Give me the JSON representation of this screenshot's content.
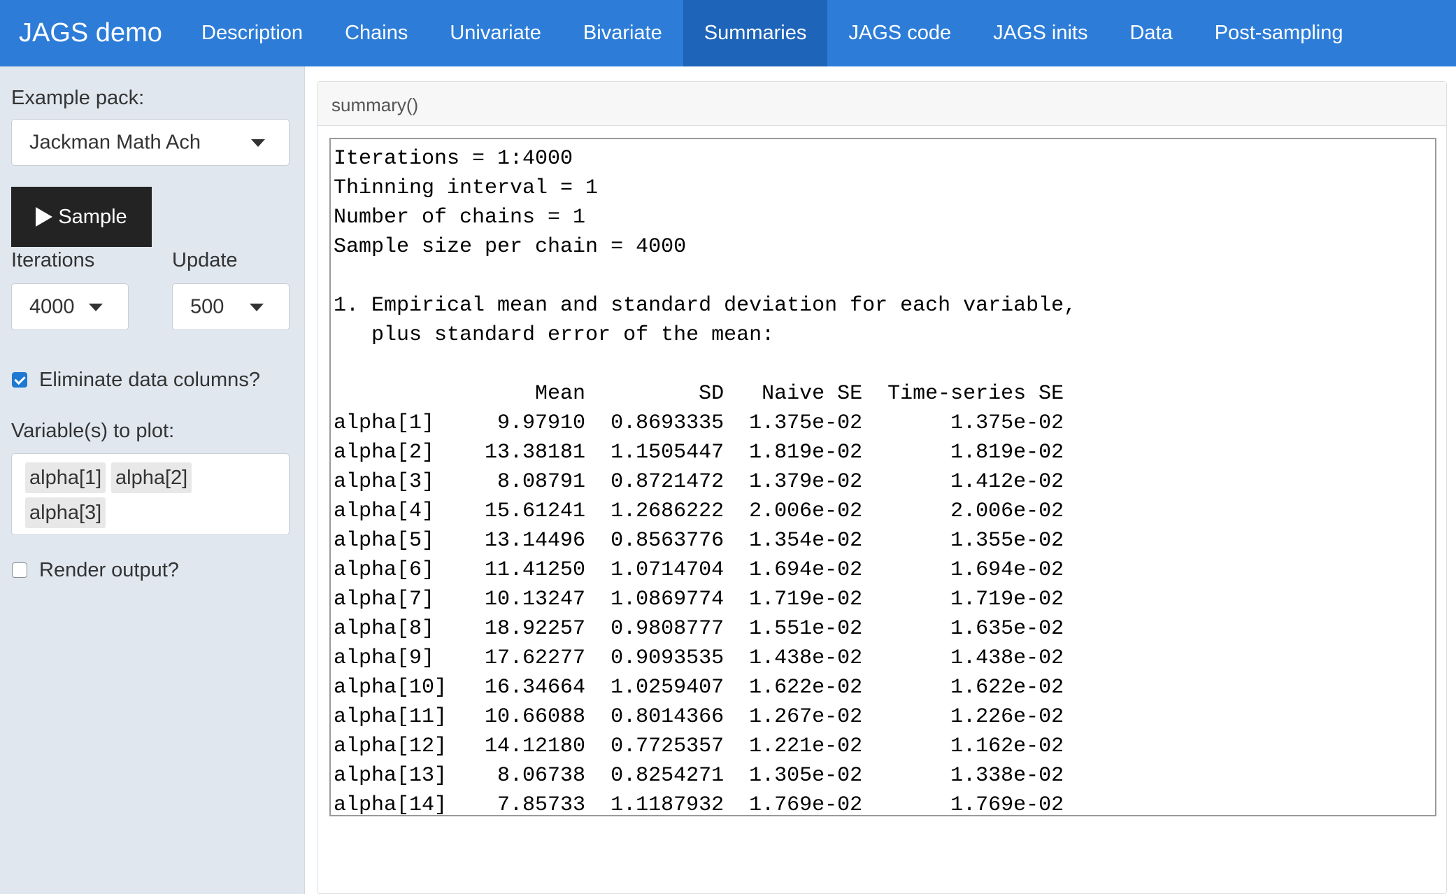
{
  "navbar": {
    "brand": "JAGS demo",
    "tabs": [
      {
        "label": "Description"
      },
      {
        "label": "Chains"
      },
      {
        "label": "Univariate"
      },
      {
        "label": "Bivariate"
      },
      {
        "label": "Summaries"
      },
      {
        "label": "JAGS code"
      },
      {
        "label": "JAGS inits"
      },
      {
        "label": "Data"
      },
      {
        "label": "Post-sampling"
      }
    ],
    "active_tab": "Summaries",
    "colors": {
      "background": "#2d7dd8",
      "active": "#1e64b8"
    }
  },
  "sidebar": {
    "example_pack_label": "Example pack:",
    "example_pack_value": "Jackman Math Ach",
    "sample_button_label": "Sample",
    "iterations_label": "Iterations",
    "iterations_value": "4000",
    "update_label": "Update",
    "update_value": "500",
    "eliminate_label": "Eliminate data columns?",
    "eliminate_checked": true,
    "variables_label": "Variable(s) to plot:",
    "variables": [
      "alpha[1]",
      "alpha[2]",
      "alpha[3]"
    ],
    "render_label": "Render output?",
    "render_checked": false
  },
  "main": {
    "panel_title": "summary()",
    "output_header": [
      "Iterations = 1:4000",
      "Thinning interval = 1",
      "Number of chains = 1",
      "Sample size per chain = 4000",
      "",
      "1. Empirical mean and standard deviation for each variable,",
      "   plus standard error of the mean:",
      ""
    ],
    "table_columns": [
      "",
      "Mean",
      "SD",
      "Naive SE",
      "Time-series SE"
    ],
    "table_rows": [
      [
        "alpha[1]",
        "9.97910",
        "0.8693335",
        "1.375e-02",
        "1.375e-02"
      ],
      [
        "alpha[2]",
        "13.38181",
        "1.1505447",
        "1.819e-02",
        "1.819e-02"
      ],
      [
        "alpha[3]",
        "8.08791",
        "0.8721472",
        "1.379e-02",
        "1.412e-02"
      ],
      [
        "alpha[4]",
        "15.61241",
        "1.2686222",
        "2.006e-02",
        "2.006e-02"
      ],
      [
        "alpha[5]",
        "13.14496",
        "0.8563776",
        "1.354e-02",
        "1.355e-02"
      ],
      [
        "alpha[6]",
        "11.41250",
        "1.0714704",
        "1.694e-02",
        "1.694e-02"
      ],
      [
        "alpha[7]",
        "10.13247",
        "1.0869774",
        "1.719e-02",
        "1.719e-02"
      ],
      [
        "alpha[8]",
        "18.92257",
        "0.9808777",
        "1.551e-02",
        "1.635e-02"
      ],
      [
        "alpha[9]",
        "17.62277",
        "0.9093535",
        "1.438e-02",
        "1.438e-02"
      ],
      [
        "alpha[10]",
        "16.34664",
        "1.0259407",
        "1.622e-02",
        "1.622e-02"
      ],
      [
        "alpha[11]",
        "10.66088",
        "0.8014366",
        "1.267e-02",
        "1.226e-02"
      ],
      [
        "alpha[12]",
        "14.12180",
        "0.7725357",
        "1.221e-02",
        "1.162e-02"
      ],
      [
        "alpha[13]",
        "8.06738",
        "0.8254271",
        "1.305e-02",
        "1.338e-02"
      ],
      [
        "alpha[14]",
        "7.85733",
        "1.1187932",
        "1.769e-02",
        "1.769e-02"
      ]
    ]
  }
}
